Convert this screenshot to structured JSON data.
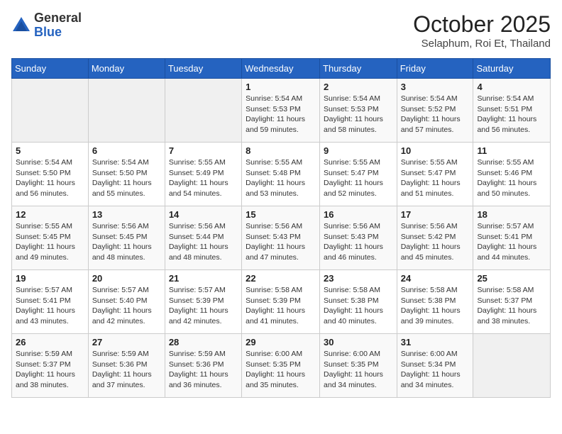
{
  "header": {
    "logo_line1": "General",
    "logo_line2": "Blue",
    "month": "October 2025",
    "location": "Selaphum, Roi Et, Thailand"
  },
  "weekdays": [
    "Sunday",
    "Monday",
    "Tuesday",
    "Wednesday",
    "Thursday",
    "Friday",
    "Saturday"
  ],
  "weeks": [
    [
      {
        "day": "",
        "info": ""
      },
      {
        "day": "",
        "info": ""
      },
      {
        "day": "",
        "info": ""
      },
      {
        "day": "1",
        "info": "Sunrise: 5:54 AM\nSunset: 5:53 PM\nDaylight: 11 hours\nand 59 minutes."
      },
      {
        "day": "2",
        "info": "Sunrise: 5:54 AM\nSunset: 5:53 PM\nDaylight: 11 hours\nand 58 minutes."
      },
      {
        "day": "3",
        "info": "Sunrise: 5:54 AM\nSunset: 5:52 PM\nDaylight: 11 hours\nand 57 minutes."
      },
      {
        "day": "4",
        "info": "Sunrise: 5:54 AM\nSunset: 5:51 PM\nDaylight: 11 hours\nand 56 minutes."
      }
    ],
    [
      {
        "day": "5",
        "info": "Sunrise: 5:54 AM\nSunset: 5:50 PM\nDaylight: 11 hours\nand 56 minutes."
      },
      {
        "day": "6",
        "info": "Sunrise: 5:54 AM\nSunset: 5:50 PM\nDaylight: 11 hours\nand 55 minutes."
      },
      {
        "day": "7",
        "info": "Sunrise: 5:55 AM\nSunset: 5:49 PM\nDaylight: 11 hours\nand 54 minutes."
      },
      {
        "day": "8",
        "info": "Sunrise: 5:55 AM\nSunset: 5:48 PM\nDaylight: 11 hours\nand 53 minutes."
      },
      {
        "day": "9",
        "info": "Sunrise: 5:55 AM\nSunset: 5:47 PM\nDaylight: 11 hours\nand 52 minutes."
      },
      {
        "day": "10",
        "info": "Sunrise: 5:55 AM\nSunset: 5:47 PM\nDaylight: 11 hours\nand 51 minutes."
      },
      {
        "day": "11",
        "info": "Sunrise: 5:55 AM\nSunset: 5:46 PM\nDaylight: 11 hours\nand 50 minutes."
      }
    ],
    [
      {
        "day": "12",
        "info": "Sunrise: 5:55 AM\nSunset: 5:45 PM\nDaylight: 11 hours\nand 49 minutes."
      },
      {
        "day": "13",
        "info": "Sunrise: 5:56 AM\nSunset: 5:45 PM\nDaylight: 11 hours\nand 48 minutes."
      },
      {
        "day": "14",
        "info": "Sunrise: 5:56 AM\nSunset: 5:44 PM\nDaylight: 11 hours\nand 48 minutes."
      },
      {
        "day": "15",
        "info": "Sunrise: 5:56 AM\nSunset: 5:43 PM\nDaylight: 11 hours\nand 47 minutes."
      },
      {
        "day": "16",
        "info": "Sunrise: 5:56 AM\nSunset: 5:43 PM\nDaylight: 11 hours\nand 46 minutes."
      },
      {
        "day": "17",
        "info": "Sunrise: 5:56 AM\nSunset: 5:42 PM\nDaylight: 11 hours\nand 45 minutes."
      },
      {
        "day": "18",
        "info": "Sunrise: 5:57 AM\nSunset: 5:41 PM\nDaylight: 11 hours\nand 44 minutes."
      }
    ],
    [
      {
        "day": "19",
        "info": "Sunrise: 5:57 AM\nSunset: 5:41 PM\nDaylight: 11 hours\nand 43 minutes."
      },
      {
        "day": "20",
        "info": "Sunrise: 5:57 AM\nSunset: 5:40 PM\nDaylight: 11 hours\nand 42 minutes."
      },
      {
        "day": "21",
        "info": "Sunrise: 5:57 AM\nSunset: 5:39 PM\nDaylight: 11 hours\nand 42 minutes."
      },
      {
        "day": "22",
        "info": "Sunrise: 5:58 AM\nSunset: 5:39 PM\nDaylight: 11 hours\nand 41 minutes."
      },
      {
        "day": "23",
        "info": "Sunrise: 5:58 AM\nSunset: 5:38 PM\nDaylight: 11 hours\nand 40 minutes."
      },
      {
        "day": "24",
        "info": "Sunrise: 5:58 AM\nSunset: 5:38 PM\nDaylight: 11 hours\nand 39 minutes."
      },
      {
        "day": "25",
        "info": "Sunrise: 5:58 AM\nSunset: 5:37 PM\nDaylight: 11 hours\nand 38 minutes."
      }
    ],
    [
      {
        "day": "26",
        "info": "Sunrise: 5:59 AM\nSunset: 5:37 PM\nDaylight: 11 hours\nand 38 minutes."
      },
      {
        "day": "27",
        "info": "Sunrise: 5:59 AM\nSunset: 5:36 PM\nDaylight: 11 hours\nand 37 minutes."
      },
      {
        "day": "28",
        "info": "Sunrise: 5:59 AM\nSunset: 5:36 PM\nDaylight: 11 hours\nand 36 minutes."
      },
      {
        "day": "29",
        "info": "Sunrise: 6:00 AM\nSunset: 5:35 PM\nDaylight: 11 hours\nand 35 minutes."
      },
      {
        "day": "30",
        "info": "Sunrise: 6:00 AM\nSunset: 5:35 PM\nDaylight: 11 hours\nand 34 minutes."
      },
      {
        "day": "31",
        "info": "Sunrise: 6:00 AM\nSunset: 5:34 PM\nDaylight: 11 hours\nand 34 minutes."
      },
      {
        "day": "",
        "info": ""
      }
    ]
  ]
}
